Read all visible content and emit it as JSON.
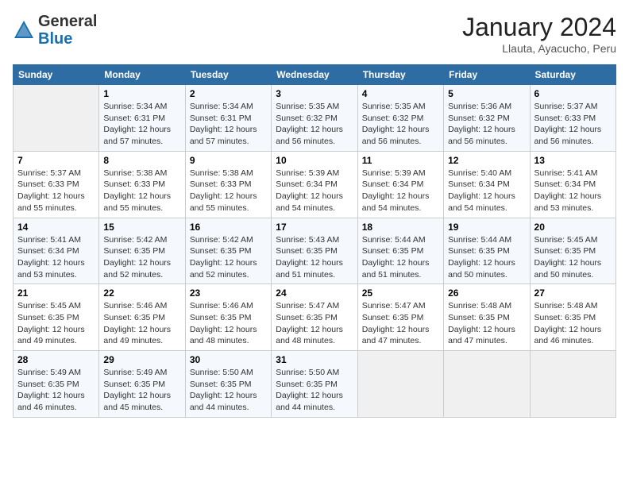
{
  "header": {
    "logo": {
      "general": "General",
      "blue": "Blue"
    },
    "title": "January 2024",
    "location": "Llauta, Ayacucho, Peru"
  },
  "columns": [
    "Sunday",
    "Monday",
    "Tuesday",
    "Wednesday",
    "Thursday",
    "Friday",
    "Saturday"
  ],
  "weeks": [
    [
      {
        "num": "",
        "info": ""
      },
      {
        "num": "1",
        "info": "Sunrise: 5:34 AM\nSunset: 6:31 PM\nDaylight: 12 hours\nand 57 minutes."
      },
      {
        "num": "2",
        "info": "Sunrise: 5:34 AM\nSunset: 6:31 PM\nDaylight: 12 hours\nand 57 minutes."
      },
      {
        "num": "3",
        "info": "Sunrise: 5:35 AM\nSunset: 6:32 PM\nDaylight: 12 hours\nand 56 minutes."
      },
      {
        "num": "4",
        "info": "Sunrise: 5:35 AM\nSunset: 6:32 PM\nDaylight: 12 hours\nand 56 minutes."
      },
      {
        "num": "5",
        "info": "Sunrise: 5:36 AM\nSunset: 6:32 PM\nDaylight: 12 hours\nand 56 minutes."
      },
      {
        "num": "6",
        "info": "Sunrise: 5:37 AM\nSunset: 6:33 PM\nDaylight: 12 hours\nand 56 minutes."
      }
    ],
    [
      {
        "num": "7",
        "info": "Sunrise: 5:37 AM\nSunset: 6:33 PM\nDaylight: 12 hours\nand 55 minutes."
      },
      {
        "num": "8",
        "info": "Sunrise: 5:38 AM\nSunset: 6:33 PM\nDaylight: 12 hours\nand 55 minutes."
      },
      {
        "num": "9",
        "info": "Sunrise: 5:38 AM\nSunset: 6:33 PM\nDaylight: 12 hours\nand 55 minutes."
      },
      {
        "num": "10",
        "info": "Sunrise: 5:39 AM\nSunset: 6:34 PM\nDaylight: 12 hours\nand 54 minutes."
      },
      {
        "num": "11",
        "info": "Sunrise: 5:39 AM\nSunset: 6:34 PM\nDaylight: 12 hours\nand 54 minutes."
      },
      {
        "num": "12",
        "info": "Sunrise: 5:40 AM\nSunset: 6:34 PM\nDaylight: 12 hours\nand 54 minutes."
      },
      {
        "num": "13",
        "info": "Sunrise: 5:41 AM\nSunset: 6:34 PM\nDaylight: 12 hours\nand 53 minutes."
      }
    ],
    [
      {
        "num": "14",
        "info": "Sunrise: 5:41 AM\nSunset: 6:34 PM\nDaylight: 12 hours\nand 53 minutes."
      },
      {
        "num": "15",
        "info": "Sunrise: 5:42 AM\nSunset: 6:35 PM\nDaylight: 12 hours\nand 52 minutes."
      },
      {
        "num": "16",
        "info": "Sunrise: 5:42 AM\nSunset: 6:35 PM\nDaylight: 12 hours\nand 52 minutes."
      },
      {
        "num": "17",
        "info": "Sunrise: 5:43 AM\nSunset: 6:35 PM\nDaylight: 12 hours\nand 51 minutes."
      },
      {
        "num": "18",
        "info": "Sunrise: 5:44 AM\nSunset: 6:35 PM\nDaylight: 12 hours\nand 51 minutes."
      },
      {
        "num": "19",
        "info": "Sunrise: 5:44 AM\nSunset: 6:35 PM\nDaylight: 12 hours\nand 50 minutes."
      },
      {
        "num": "20",
        "info": "Sunrise: 5:45 AM\nSunset: 6:35 PM\nDaylight: 12 hours\nand 50 minutes."
      }
    ],
    [
      {
        "num": "21",
        "info": "Sunrise: 5:45 AM\nSunset: 6:35 PM\nDaylight: 12 hours\nand 49 minutes."
      },
      {
        "num": "22",
        "info": "Sunrise: 5:46 AM\nSunset: 6:35 PM\nDaylight: 12 hours\nand 49 minutes."
      },
      {
        "num": "23",
        "info": "Sunrise: 5:46 AM\nSunset: 6:35 PM\nDaylight: 12 hours\nand 48 minutes."
      },
      {
        "num": "24",
        "info": "Sunrise: 5:47 AM\nSunset: 6:35 PM\nDaylight: 12 hours\nand 48 minutes."
      },
      {
        "num": "25",
        "info": "Sunrise: 5:47 AM\nSunset: 6:35 PM\nDaylight: 12 hours\nand 47 minutes."
      },
      {
        "num": "26",
        "info": "Sunrise: 5:48 AM\nSunset: 6:35 PM\nDaylight: 12 hours\nand 47 minutes."
      },
      {
        "num": "27",
        "info": "Sunrise: 5:48 AM\nSunset: 6:35 PM\nDaylight: 12 hours\nand 46 minutes."
      }
    ],
    [
      {
        "num": "28",
        "info": "Sunrise: 5:49 AM\nSunset: 6:35 PM\nDaylight: 12 hours\nand 46 minutes."
      },
      {
        "num": "29",
        "info": "Sunrise: 5:49 AM\nSunset: 6:35 PM\nDaylight: 12 hours\nand 45 minutes."
      },
      {
        "num": "30",
        "info": "Sunrise: 5:50 AM\nSunset: 6:35 PM\nDaylight: 12 hours\nand 44 minutes."
      },
      {
        "num": "31",
        "info": "Sunrise: 5:50 AM\nSunset: 6:35 PM\nDaylight: 12 hours\nand 44 minutes."
      },
      {
        "num": "",
        "info": ""
      },
      {
        "num": "",
        "info": ""
      },
      {
        "num": "",
        "info": ""
      }
    ]
  ]
}
